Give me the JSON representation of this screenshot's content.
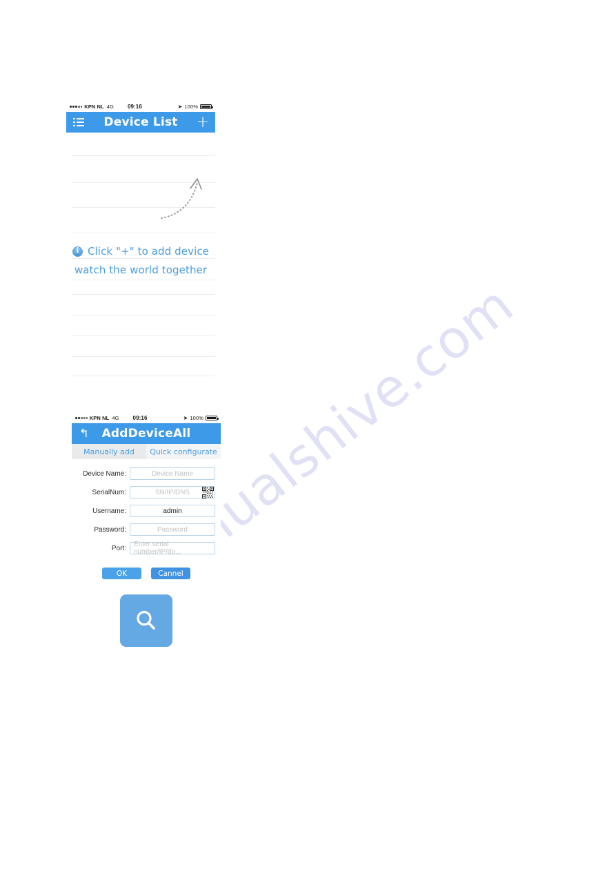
{
  "watermark": {
    "text": "manualshive.com"
  },
  "screen_device_list": {
    "status_bar": {
      "carrier": "KPN NL",
      "network": "4G",
      "time": "09:16",
      "battery_percent": "100%",
      "location_icon": "location-arrow-icon",
      "signal_dots_filled": 3,
      "signal_dots_total": 5
    },
    "navbar": {
      "menu_icon": "list-menu-icon",
      "title": "Device List",
      "add_icon": "plus-icon",
      "bg_color": "#3d9ae8"
    },
    "hint": {
      "info_icon": "info-circle-icon",
      "line1": "Click \"+\" to add device",
      "line2": "watch the world together",
      "text_color": "#4a9de0"
    },
    "arrow": {
      "icon": "dashed-curved-arrow-icon"
    },
    "empty_rows": 9
  },
  "screen_add_device": {
    "status_bar": {
      "carrier": "KPN NL",
      "network": "4G",
      "time": "09:16",
      "battery_percent": "100%",
      "location_icon": "location-arrow-icon",
      "signal_dots_filled": 2,
      "signal_dots_total": 5
    },
    "navbar": {
      "back_icon": "back-arrow-icon",
      "title": "AddDeviceAll",
      "bg_color": "#3d9ae8"
    },
    "tabs": [
      {
        "label": "Manually add",
        "active": false
      },
      {
        "label": "Quick configurate",
        "active": true
      }
    ],
    "form": [
      {
        "label": "Device Name:",
        "placeholder": "Device Name",
        "value": "",
        "icon": ""
      },
      {
        "label": "SerialNum:",
        "placeholder": "SN/IP/DNS",
        "value": "",
        "icon": "qr-code-icon"
      },
      {
        "label": "Username:",
        "placeholder": "",
        "value": "admin",
        "icon": ""
      },
      {
        "label": "Password:",
        "placeholder": "Password",
        "value": "",
        "icon": ""
      },
      {
        "label": "Port:",
        "placeholder": "Enter serial number/IP/do...",
        "value": "",
        "icon": ""
      }
    ],
    "buttons": {
      "ok": "OK",
      "cancel": "Cannel"
    },
    "search_button": {
      "icon": "search-magnifier-icon",
      "bg_color": "#64a8e4"
    }
  }
}
